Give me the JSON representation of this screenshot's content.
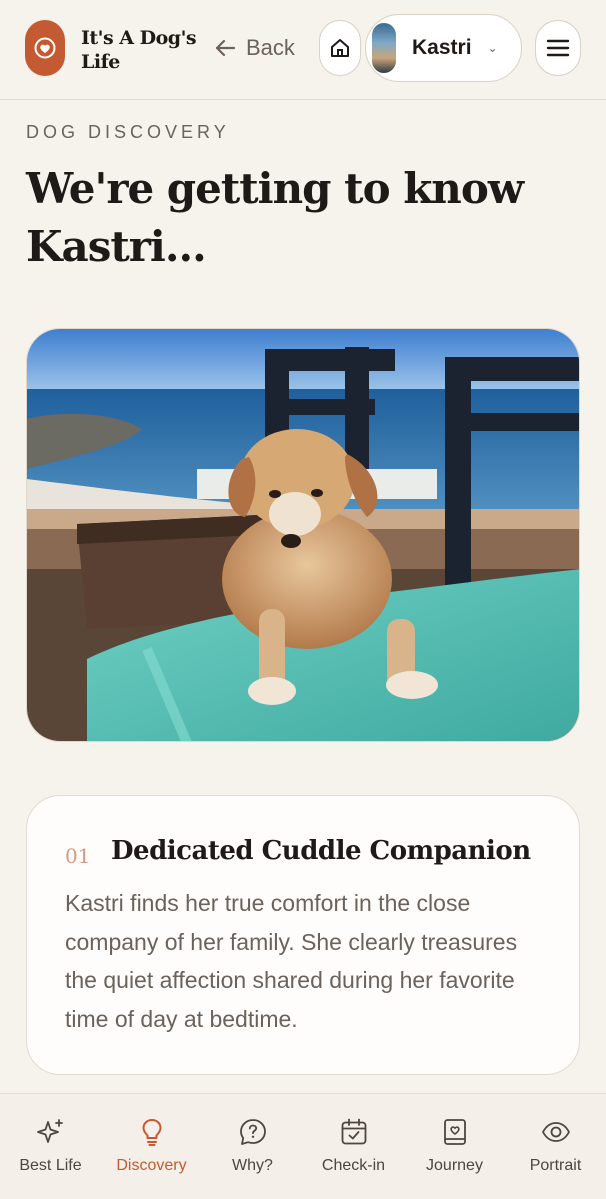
{
  "header": {
    "brand": "It's A Dog's Life",
    "back_label": "Back",
    "dog_selector": {
      "name": "Kastri"
    }
  },
  "discovery": {
    "eyebrow": "DOG DISCOVERY",
    "title": "We're getting to know Kastri..."
  },
  "trait_card": {
    "number": "01",
    "title": "Dedicated Cuddle Companion",
    "body": "Kastri finds her true comfort in the close company of her family. She clearly treasures the quiet affection shared during her favorite time of day at bedtime."
  },
  "bottom_nav": {
    "items": [
      {
        "label": "Best Life",
        "icon": "sparkles-icon"
      },
      {
        "label": "Discovery",
        "icon": "lightbulb-icon",
        "active": true
      },
      {
        "label": "Why?",
        "icon": "question-bubble-icon"
      },
      {
        "label": "Check-in",
        "icon": "calendar-check-icon"
      },
      {
        "label": "Journey",
        "icon": "journal-heart-icon"
      },
      {
        "label": "Portrait",
        "icon": "eye-icon"
      }
    ]
  },
  "colors": {
    "accent": "#c45a32",
    "background": "#f6f2ec",
    "card": "#fefdfb",
    "muted_text": "#6b625b",
    "number_accent": "#d59a85"
  }
}
